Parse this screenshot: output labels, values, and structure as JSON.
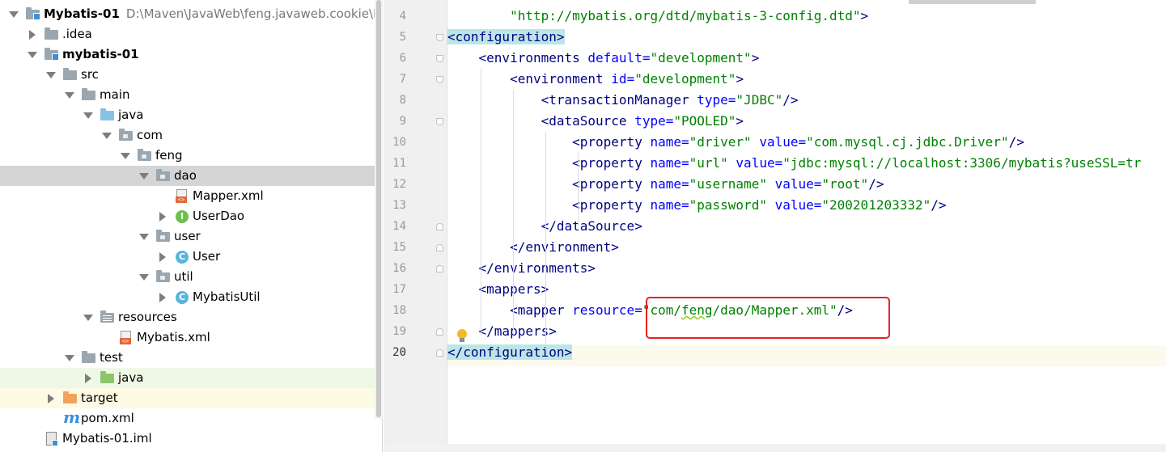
{
  "project_tree": {
    "items": [
      {
        "label": "Mybatis-01",
        "path": "D:\\Maven\\JavaWeb\\feng.javaweb.cookie\\Myb",
        "icon": "module-folder-icon",
        "depth": 0,
        "arrow": "down",
        "bold": true
      },
      {
        "label": ".idea",
        "icon": "folder-icon",
        "depth": 1,
        "arrow": "right"
      },
      {
        "label": "mybatis-01",
        "icon": "module-folder-icon",
        "depth": 1,
        "arrow": "down",
        "bold": true
      },
      {
        "label": "src",
        "icon": "folder-icon",
        "depth": 2,
        "arrow": "down"
      },
      {
        "label": "main",
        "icon": "folder-icon",
        "depth": 3,
        "arrow": "down"
      },
      {
        "label": "java",
        "icon": "source-folder-icon",
        "depth": 4,
        "arrow": "down"
      },
      {
        "label": "com",
        "icon": "package-icon",
        "depth": 5,
        "arrow": "down"
      },
      {
        "label": "feng",
        "icon": "package-icon",
        "depth": 6,
        "arrow": "down"
      },
      {
        "label": "dao",
        "icon": "package-icon",
        "depth": 7,
        "arrow": "down",
        "selected": true
      },
      {
        "label": "Mapper.xml",
        "icon": "xml-file-icon",
        "depth": 8
      },
      {
        "label": "UserDao",
        "icon": "interface-icon",
        "depth": 8,
        "arrow": "right"
      },
      {
        "label": "user",
        "icon": "package-icon",
        "depth": 7,
        "arrow": "down"
      },
      {
        "label": "User",
        "icon": "class-icon",
        "depth": 8,
        "arrow": "right"
      },
      {
        "label": "util",
        "icon": "package-icon",
        "depth": 7,
        "arrow": "down"
      },
      {
        "label": "MybatisUtil",
        "icon": "class-icon",
        "depth": 8,
        "arrow": "right"
      },
      {
        "label": "resources",
        "icon": "resources-folder-icon",
        "depth": 4,
        "arrow": "down"
      },
      {
        "label": "Mybatis.xml",
        "icon": "xml-file-icon",
        "depth": 5
      },
      {
        "label": "test",
        "icon": "folder-icon",
        "depth": 3,
        "arrow": "down"
      },
      {
        "label": "java",
        "icon": "test-source-folder-icon",
        "depth": 4,
        "arrow": "right"
      },
      {
        "label": "target",
        "icon": "excluded-folder-icon",
        "depth": 2,
        "arrow": "right"
      },
      {
        "label": "pom.xml",
        "icon": "maven-icon",
        "depth": 2
      },
      {
        "label": "Mybatis-01.iml",
        "icon": "iml-file-icon",
        "depth": 1
      }
    ]
  },
  "editor": {
    "lines": [
      {
        "num": "4",
        "code": [
          {
            "t": "        ",
            "c": ""
          },
          {
            "t": "\"http://mybatis.org/dtd/mybatis-3-config.dtd\"",
            "c": "vl"
          },
          {
            "t": ">",
            "c": "tg"
          }
        ]
      },
      {
        "num": "5",
        "code": [
          {
            "t": "<configuration>",
            "c": "tg mt"
          }
        ]
      },
      {
        "num": "6",
        "code": [
          {
            "t": "    <environments ",
            "c": "tg"
          },
          {
            "t": "default=",
            "c": "at"
          },
          {
            "t": "\"development\"",
            "c": "vl"
          },
          {
            "t": ">",
            "c": "tg"
          }
        ]
      },
      {
        "num": "7",
        "code": [
          {
            "t": "        <environment ",
            "c": "tg"
          },
          {
            "t": "id=",
            "c": "at"
          },
          {
            "t": "\"development\"",
            "c": "vl"
          },
          {
            "t": ">",
            "c": "tg"
          }
        ]
      },
      {
        "num": "8",
        "code": [
          {
            "t": "            <transactionManager ",
            "c": "tg"
          },
          {
            "t": "type=",
            "c": "at"
          },
          {
            "t": "\"JDBC\"",
            "c": "vl"
          },
          {
            "t": "/>",
            "c": "tg"
          }
        ]
      },
      {
        "num": "9",
        "code": [
          {
            "t": "            <dataSource ",
            "c": "tg"
          },
          {
            "t": "type=",
            "c": "at"
          },
          {
            "t": "\"POOLED\"",
            "c": "vl"
          },
          {
            "t": ">",
            "c": "tg"
          }
        ]
      },
      {
        "num": "10",
        "code": [
          {
            "t": "                <property ",
            "c": "tg"
          },
          {
            "t": "name=",
            "c": "at"
          },
          {
            "t": "\"driver\" ",
            "c": "vl"
          },
          {
            "t": "value=",
            "c": "at"
          },
          {
            "t": "\"com.mysql.cj.jdbc.Driver\"",
            "c": "vl"
          },
          {
            "t": "/>",
            "c": "tg"
          }
        ]
      },
      {
        "num": "11",
        "code": [
          {
            "t": "                <property ",
            "c": "tg"
          },
          {
            "t": "name=",
            "c": "at"
          },
          {
            "t": "\"url\" ",
            "c": "vl"
          },
          {
            "t": "value=",
            "c": "at"
          },
          {
            "t": "\"jdbc:mysql://localhost:3306/mybatis?useSSL=tr",
            "c": "vl"
          }
        ]
      },
      {
        "num": "12",
        "code": [
          {
            "t": "                <property ",
            "c": "tg"
          },
          {
            "t": "name=",
            "c": "at"
          },
          {
            "t": "\"username\" ",
            "c": "vl"
          },
          {
            "t": "value=",
            "c": "at"
          },
          {
            "t": "\"root\"",
            "c": "vl"
          },
          {
            "t": "/>",
            "c": "tg"
          }
        ]
      },
      {
        "num": "13",
        "code": [
          {
            "t": "                <property ",
            "c": "tg"
          },
          {
            "t": "name=",
            "c": "at"
          },
          {
            "t": "\"password\" ",
            "c": "vl"
          },
          {
            "t": "value=",
            "c": "at"
          },
          {
            "t": "\"200201203332\"",
            "c": "vl"
          },
          {
            "t": "/>",
            "c": "tg"
          }
        ]
      },
      {
        "num": "14",
        "code": [
          {
            "t": "            </dataSource>",
            "c": "tg"
          }
        ]
      },
      {
        "num": "15",
        "code": [
          {
            "t": "        </environment>",
            "c": "tg"
          }
        ]
      },
      {
        "num": "16",
        "code": [
          {
            "t": "    </environments>",
            "c": "tg"
          }
        ]
      },
      {
        "num": "17",
        "code": [
          {
            "t": "    <mappers>",
            "c": "tg"
          }
        ]
      },
      {
        "num": "18",
        "code": [
          {
            "t": "        <mapper ",
            "c": "tg"
          },
          {
            "t": "resource=",
            "c": "at"
          },
          {
            "t": "\"com/",
            "c": "vl"
          },
          {
            "t": "feng",
            "c": "vl ul"
          },
          {
            "t": "/dao/Mapper.xml\"",
            "c": "vl"
          },
          {
            "t": "/>",
            "c": "tg"
          }
        ]
      },
      {
        "num": "19",
        "code": [
          {
            "t": "    </mappers>",
            "c": "tg"
          }
        ]
      },
      {
        "num": "20",
        "code": [
          {
            "t": "</configuration>",
            "c": "tg mt"
          }
        ]
      }
    ],
    "current_line": "20"
  },
  "colors": {
    "tag": "#000080",
    "attribute": "#0000ff",
    "value": "#008000",
    "highlight_box": "#e52222"
  }
}
